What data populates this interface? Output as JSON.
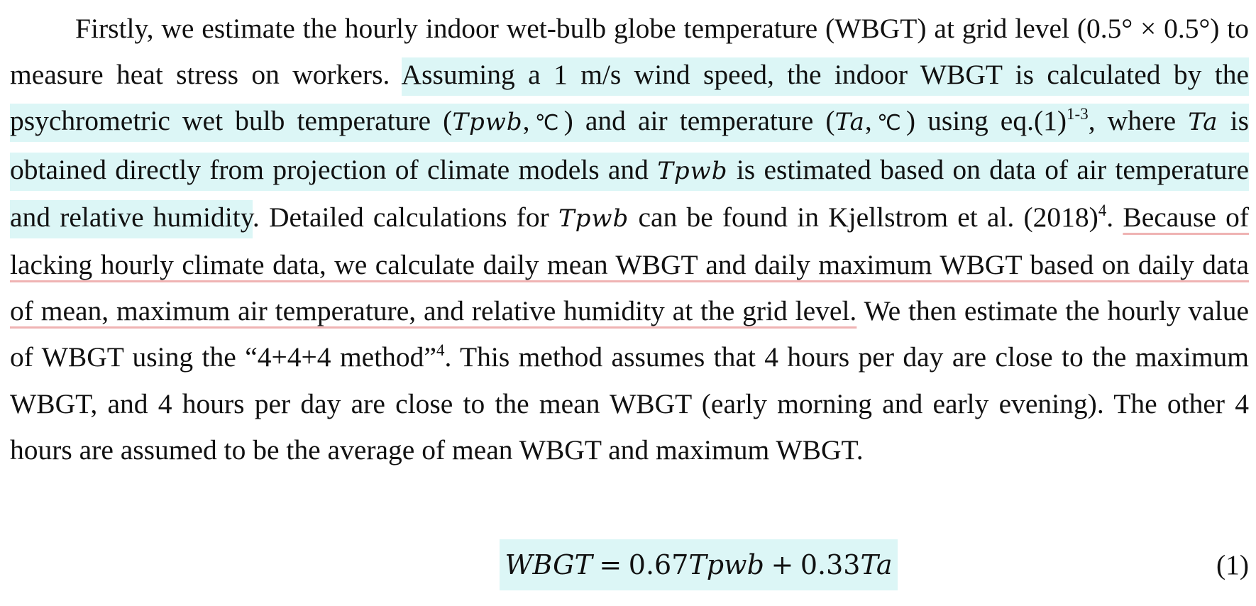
{
  "paragraph": {
    "s1": "Firstly, we estimate the hourly indoor wet-bulb globe temperature (WBGT) at grid level (0.5° × 0.5°) to measure heat stress on workers. ",
    "h1": "Assuming a 1 m/s wind speed, the indoor WBGT is calculated by the psychrometric wet bulb temperature (",
    "tpwb_1": "Tpwb",
    "h2": ",",
    "degc_1": "℃",
    "h3": ") and air temperature (",
    "ta_1": "Ta",
    "h4": ",",
    "degc_2": "℃",
    "h5": ") using eq.(1)",
    "ref_1": "1-3",
    "h6": ", where ",
    "ta_2": "Ta",
    "h7": " is obtained directly from projection of climate models and ",
    "tpwb_2": "Tpwb",
    "h8": " is estimated based on data of air temperature and relative humidity",
    "s2": ". Detailed calculations for ",
    "tpwb_3": "Tpwb",
    "s3": " can be found in Kjellstrom et al. (2018)",
    "ref_2": "4",
    "s4": ". ",
    "u1": "Because of lacking hourly climate data, we calculate daily mean WBGT and daily maximum WBGT based on daily data of mean, maximum air temperature, and relative humidity at the grid level.",
    "s5": " We then estimate the hourly value of WBGT using the “4+4+4 method”",
    "ref_3": "4",
    "s6": ". This method assumes that 4 hours per day are close to the maximum WBGT, and 4 hours per day are close to the mean WBGT (early morning and early evening). The other 4 hours are assumed to be the average of mean WBGT and maximum WBGT."
  },
  "equation": {
    "formula": "WBGT = 0.67Tpwb + 0.33Ta",
    "number": "(1)"
  },
  "colors": {
    "highlight": "#dcf6f6",
    "underline": "#efb3b3",
    "text": "#111111"
  }
}
